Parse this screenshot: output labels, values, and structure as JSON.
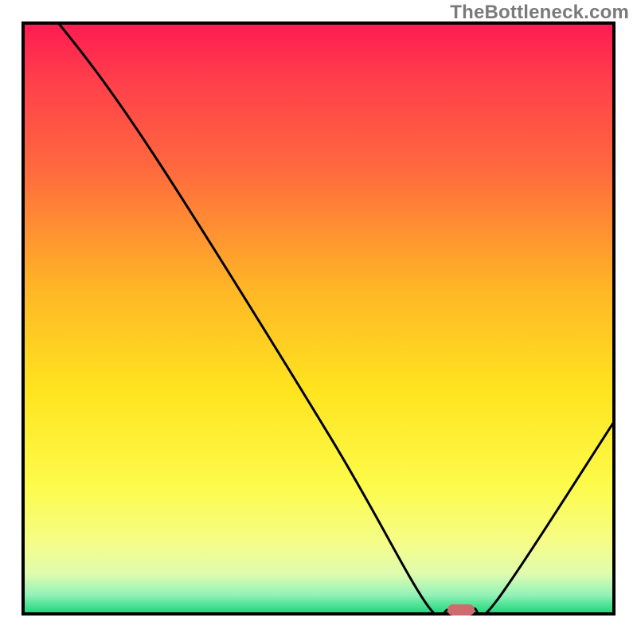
{
  "watermark": {
    "text": "TheBottleneck.com"
  },
  "chart_data": {
    "type": "line",
    "xlabel": "",
    "ylabel": "",
    "title": "",
    "xlim": [
      0,
      100
    ],
    "ylim": [
      0,
      100
    ],
    "grid": false,
    "series": [
      {
        "name": "curve",
        "x": [
          0,
          6,
          22,
          52,
          68,
          72,
          76,
          80,
          100
        ],
        "values": [
          105,
          100,
          78,
          30,
          2.2,
          1,
          1.2,
          2.5,
          33
        ]
      }
    ],
    "background_gradient": {
      "stops": [
        {
          "pos": 0.0,
          "color": "#ff1a52"
        },
        {
          "pos": 0.1,
          "color": "#ff3f4b"
        },
        {
          "pos": 0.25,
          "color": "#ff6a3e"
        },
        {
          "pos": 0.45,
          "color": "#ffb626"
        },
        {
          "pos": 0.62,
          "color": "#ffe41f"
        },
        {
          "pos": 0.78,
          "color": "#fdfb4a"
        },
        {
          "pos": 0.88,
          "color": "#f5fd8a"
        },
        {
          "pos": 0.93,
          "color": "#dffcae"
        },
        {
          "pos": 0.965,
          "color": "#94f2b9"
        },
        {
          "pos": 0.985,
          "color": "#44e08f"
        },
        {
          "pos": 1.0,
          "color": "#18d27a"
        }
      ]
    },
    "marker": {
      "x": 74,
      "y": 1
    }
  }
}
